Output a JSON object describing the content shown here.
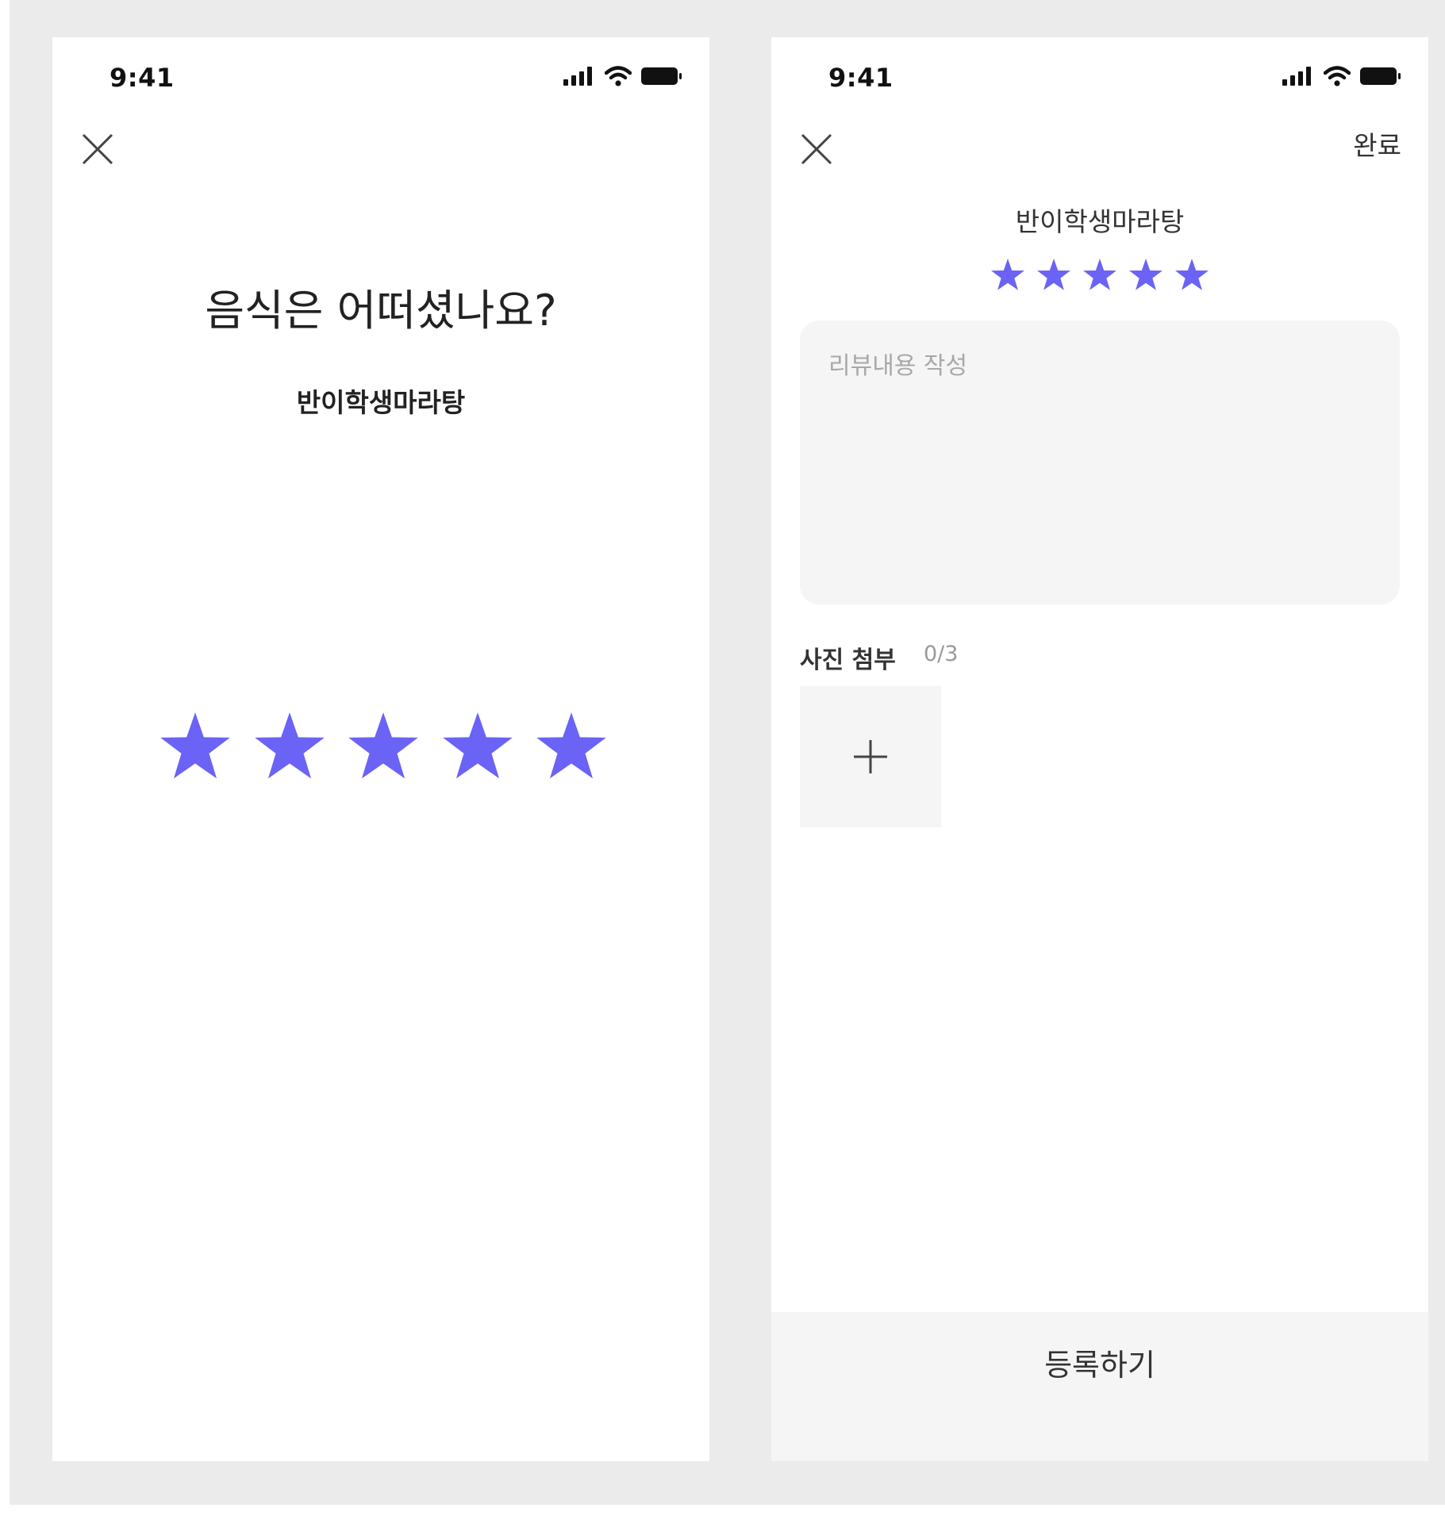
{
  "colors": {
    "star": "#6a63f5",
    "background": "#ebebeb",
    "panel": "#f5f5f5"
  },
  "icons": [
    "close-icon",
    "signal-icon",
    "wifi-icon",
    "battery-icon",
    "star-icon",
    "plus-icon"
  ],
  "left_screen": {
    "status_time": "9:41",
    "question": "음식은 어떠셨나요?",
    "restaurant_name": "반이학생마라탕",
    "rating": {
      "value": 5,
      "max": 5
    }
  },
  "right_screen": {
    "status_time": "9:41",
    "done_label": "완료",
    "restaurant_name": "반이학생마라탕",
    "rating": {
      "value": 5,
      "max": 5
    },
    "review_placeholder": "리뷰내용 작성",
    "photo_label": "사진 첨부",
    "photo_count": "0/3",
    "register_label": "등록하기"
  }
}
